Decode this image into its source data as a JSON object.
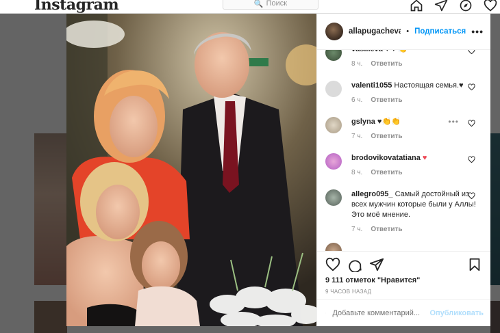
{
  "topbar": {
    "logo": "Instagram",
    "search_placeholder": "Поиск"
  },
  "post": {
    "username": "allapugachevaandl",
    "dot": "•",
    "follow_label": "Подписаться",
    "more": "•••",
    "likes": "9 111 отметок \"Нравится\"",
    "time_ago": "9 ЧАСОВ НАЗАД",
    "add_comment_placeholder": "Добавьте комментарий...",
    "post_button": "Опубликовать"
  },
  "comments": [
    {
      "user": "vasilieva",
      "text": "♥ ♥ 👏",
      "time": "8 ч.",
      "reply": "Ответить"
    },
    {
      "user": "valenti1055",
      "text": "Настоящая семья.♥",
      "time": "6 ч.",
      "reply": "Ответить"
    },
    {
      "user": "gslyna",
      "text": "♥👏👏",
      "time": "7 ч.",
      "reply": "Ответить",
      "more": "•••"
    },
    {
      "user": "brodovikovatatiana",
      "text": "♥",
      "time": "8 ч.",
      "reply": "Ответить"
    },
    {
      "user": "allegro095_",
      "text": "Самый достойный из всех мужчин которые были у Аллы! Это моё мнение.",
      "time": "7 ч.",
      "reply": "Ответить"
    }
  ],
  "colors": {
    "accent": "#0095f6",
    "heart": "#ed4956",
    "post_disabled": "#b2dffc"
  }
}
